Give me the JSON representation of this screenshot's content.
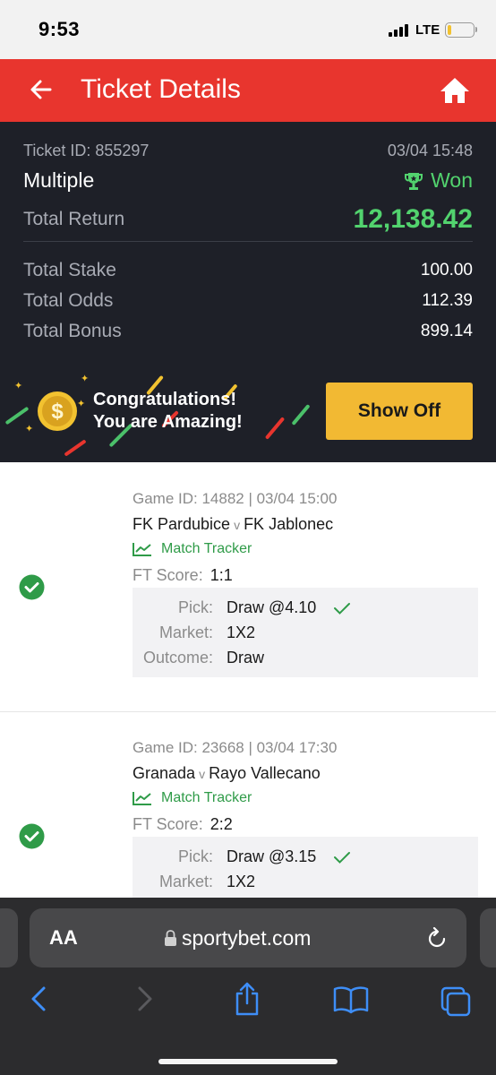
{
  "status_bar": {
    "time": "9:53",
    "network": "LTE",
    "battery_level": 0.15
  },
  "header": {
    "title": "Ticket Details",
    "back_icon": "arrow-left-icon",
    "home_icon": "home-icon"
  },
  "summary": {
    "ticket_id": "Ticket ID: 855297",
    "datetime": "03/04 15:48",
    "type": "Multiple",
    "status": "Won",
    "total_return_label": "Total Return",
    "total_return": "12,138.42",
    "total_stake_label": "Total Stake",
    "total_stake": "100.00",
    "total_odds_label": "Total Odds",
    "total_odds": "112.39",
    "total_bonus_label": "Total Bonus",
    "total_bonus": "899.14"
  },
  "banner": {
    "line1": "Congratulations!",
    "line2": "You are Amazing!",
    "button": "Show Off"
  },
  "bets": [
    {
      "game": "Game ID: 14882 | 03/04 15:00",
      "home": "FK Pardubice",
      "vs": "v",
      "away": "FK Jablonec",
      "tracker": "Match Tracker",
      "ft_label": "FT Score:",
      "ft_score": "1:1",
      "pick_label": "Pick:",
      "pick": "Draw @4.10",
      "market_label": "Market:",
      "market": "1X2",
      "outcome_label": "Outcome:",
      "outcome": "Draw"
    },
    {
      "game": "Game ID: 23668 | 03/04 17:30",
      "home": "Granada",
      "vs": "v",
      "away": "Rayo Vallecano",
      "tracker": "Match Tracker",
      "ft_label": "FT Score:",
      "ft_score": "2:2",
      "pick_label": "Pick:",
      "pick": "Draw @3.15",
      "market_label": "Market:",
      "market": "1X2"
    }
  ],
  "browser": {
    "text_size_label": "AA",
    "url": "sportybet.com",
    "icons": [
      "back-icon",
      "forward-icon",
      "share-icon",
      "bookmarks-icon",
      "tabs-icon"
    ]
  },
  "colors": {
    "brand_red": "#e8352e",
    "summary_bg": "#1e2028",
    "won_green": "#52d36e",
    "button_yellow": "#f2b933",
    "tracker_green": "#2f9b48"
  }
}
